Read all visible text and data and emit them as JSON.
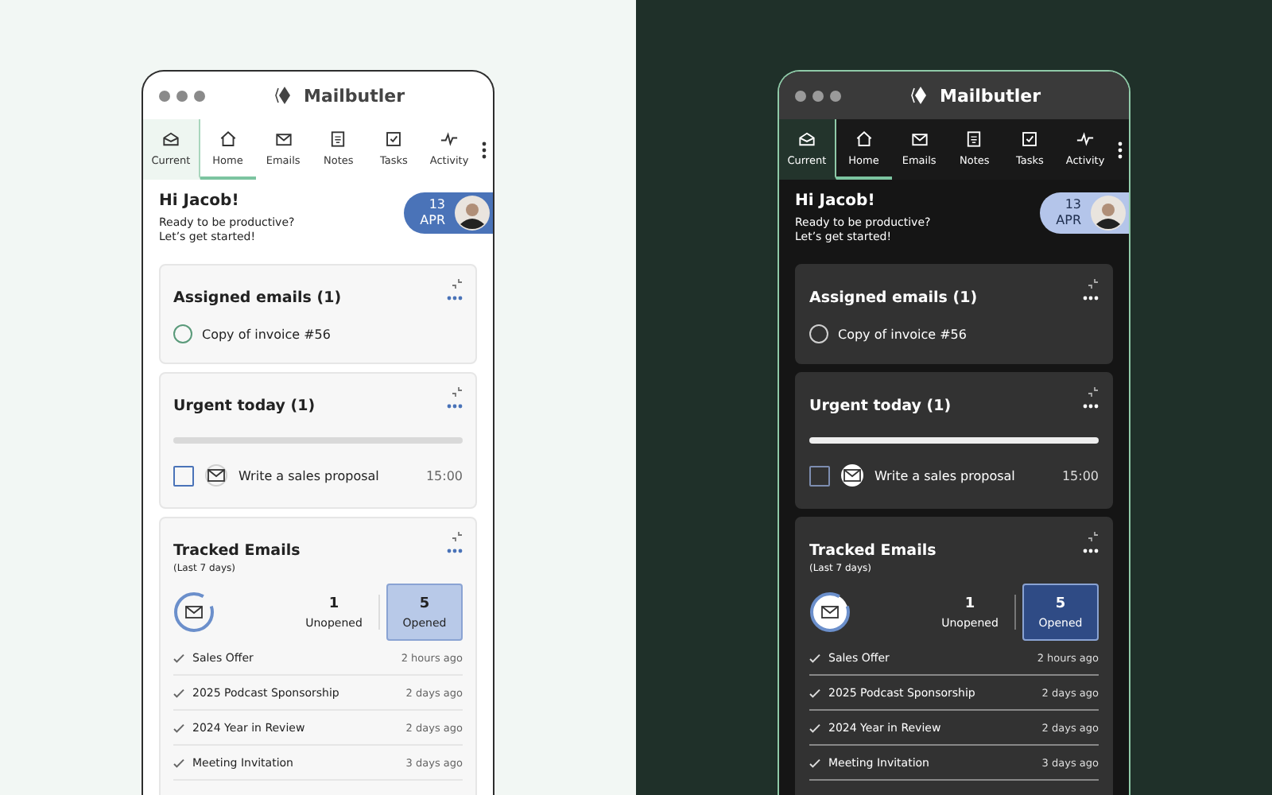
{
  "panels": [
    {
      "kind": "light",
      "title": "Mailbutler",
      "tabs": [
        {
          "label": "Current",
          "kind": "pinned",
          "selected": false
        },
        {
          "label": "Home",
          "kind": "tab",
          "selected": true
        },
        {
          "label": "Emails",
          "kind": "tab",
          "selected": false
        },
        {
          "label": "Notes",
          "kind": "tab",
          "selected": false
        },
        {
          "label": "Tasks",
          "kind": "tab",
          "selected": false
        },
        {
          "label": "Activity",
          "kind": "tab",
          "selected": false
        }
      ],
      "greeting": {
        "title": "Hi Jacob!",
        "lines": [
          "Ready to be productive?",
          "Let’s get started!"
        ]
      },
      "date": {
        "day": "13",
        "month": "APR"
      },
      "assigned": {
        "title": "Assigned emails (1)",
        "items": [
          {
            "label": "Copy of invoice #56",
            "checked": false
          }
        ]
      },
      "urgent": {
        "title": "Urgent today (1)",
        "level": 0,
        "tasks": [
          {
            "label": "Write a sales proposal",
            "time": "15:00",
            "checked": false
          }
        ]
      },
      "tracked": {
        "title": "Tracked Emails",
        "subtitle": "(Last 7 days)",
        "stats": [
          {
            "value": "1",
            "label": "Unopened",
            "selected": false
          },
          {
            "value": "5",
            "label": "Opened",
            "selected": true
          }
        ],
        "emails": [
          {
            "subject": "Sales Offer",
            "time": "2 hours ago"
          },
          {
            "subject": "2025 Podcast Sponsorship",
            "time": "2 days ago"
          },
          {
            "subject": "2024 Year in Review",
            "time": "2 days ago"
          },
          {
            "subject": "Meeting Invitation",
            "time": "3 days ago"
          }
        ]
      }
    },
    {
      "kind": "dark",
      "title": "Mailbutler",
      "tabs": [
        {
          "label": "Current",
          "kind": "pinned",
          "selected": false
        },
        {
          "label": "Home",
          "kind": "tab",
          "selected": true
        },
        {
          "label": "Emails",
          "kind": "tab",
          "selected": false
        },
        {
          "label": "Notes",
          "kind": "tab",
          "selected": false
        },
        {
          "label": "Tasks",
          "kind": "tab",
          "selected": false
        },
        {
          "label": "Activity",
          "kind": "tab",
          "selected": false
        }
      ],
      "greeting": {
        "title": "Hi Jacob!",
        "lines": [
          "Ready to be productive?",
          "Let’s get started!"
        ]
      },
      "date": {
        "day": "13",
        "month": "APR"
      },
      "assigned": {
        "title": "Assigned emails (1)",
        "items": [
          {
            "label": "Copy of invoice #56",
            "checked": false
          }
        ]
      },
      "urgent": {
        "title": "Urgent today (1)",
        "level": 0,
        "tasks": [
          {
            "label": "Write a sales proposal",
            "time": "15:00",
            "checked": false
          }
        ]
      },
      "tracked": {
        "title": "Tracked Emails",
        "subtitle": "(Last 7 days)",
        "stats": [
          {
            "value": "1",
            "label": "Unopened",
            "selected": false
          },
          {
            "value": "5",
            "label": "Opened",
            "selected": true
          }
        ],
        "emails": [
          {
            "subject": "Sales Offer",
            "time": "2 hours ago"
          },
          {
            "subject": "2025 Podcast Sponsorship",
            "time": "2 days ago"
          },
          {
            "subject": "2024 Year in Review",
            "time": "2 days ago"
          },
          {
            "subject": "Meeting Invitation",
            "time": "3 days ago"
          }
        ]
      }
    }
  ]
}
